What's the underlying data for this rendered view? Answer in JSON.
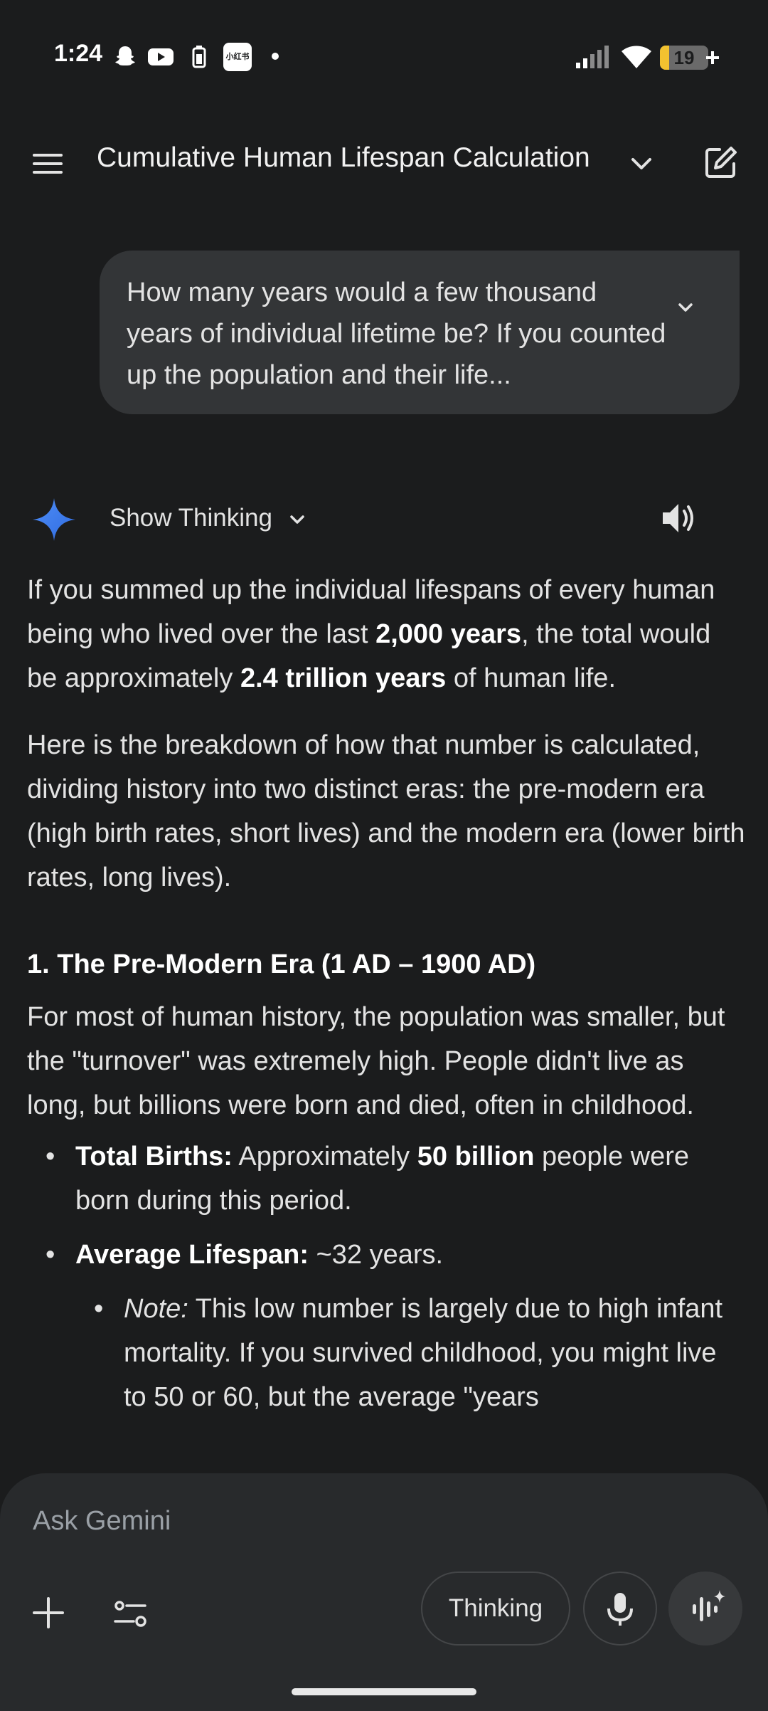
{
  "status_bar": {
    "time": "1:24",
    "battery_level": "19",
    "battery_fraction": 0.19,
    "xiaohongshu_badge": "小红书"
  },
  "app_bar": {
    "title": "Cumulative Human Lifespan Calculation"
  },
  "user_message": {
    "text": "How many years would a few thousand years of individual lifetime be? If you counted up the population and their life..."
  },
  "response_header": {
    "show_thinking_label": "Show Thinking"
  },
  "response": {
    "p1_a": "If you summed up the individual lifespans of every human being who lived over the last ",
    "p1_b": "2,000 years",
    "p1_c": ", the total would be approximately ",
    "p1_d": "2.4 trillion years",
    "p1_e": " of human life.",
    "p2": "Here is the breakdown of how that number is calculated, dividing history into two distinct eras: the pre-modern era (high birth rates, short lives) and the modern era (lower birth rates, long lives).",
    "section1_heading": "1. The Pre-Modern Era (1 AD – 1900 AD)",
    "section1_body": "For most of human history, the population was smaller, but the \"turnover\" was extremely high. People didn't live as long, but billions were born and died, often in childhood.",
    "bullet1_label": "Total Births:",
    "bullet1_a": " Approximately ",
    "bullet1_b": "50 billion",
    "bullet1_c": " people were born during this period.",
    "bullet2_label": "Average Lifespan:",
    "bullet2_text": " ~32 years.",
    "note_label": "Note:",
    "note_text": " This low number is largely due to high infant mortality. If you survived childhood, you might live to 50 or 60, but the average \"years"
  },
  "input": {
    "placeholder": "Ask Gemini",
    "thinking_label": "Thinking"
  }
}
